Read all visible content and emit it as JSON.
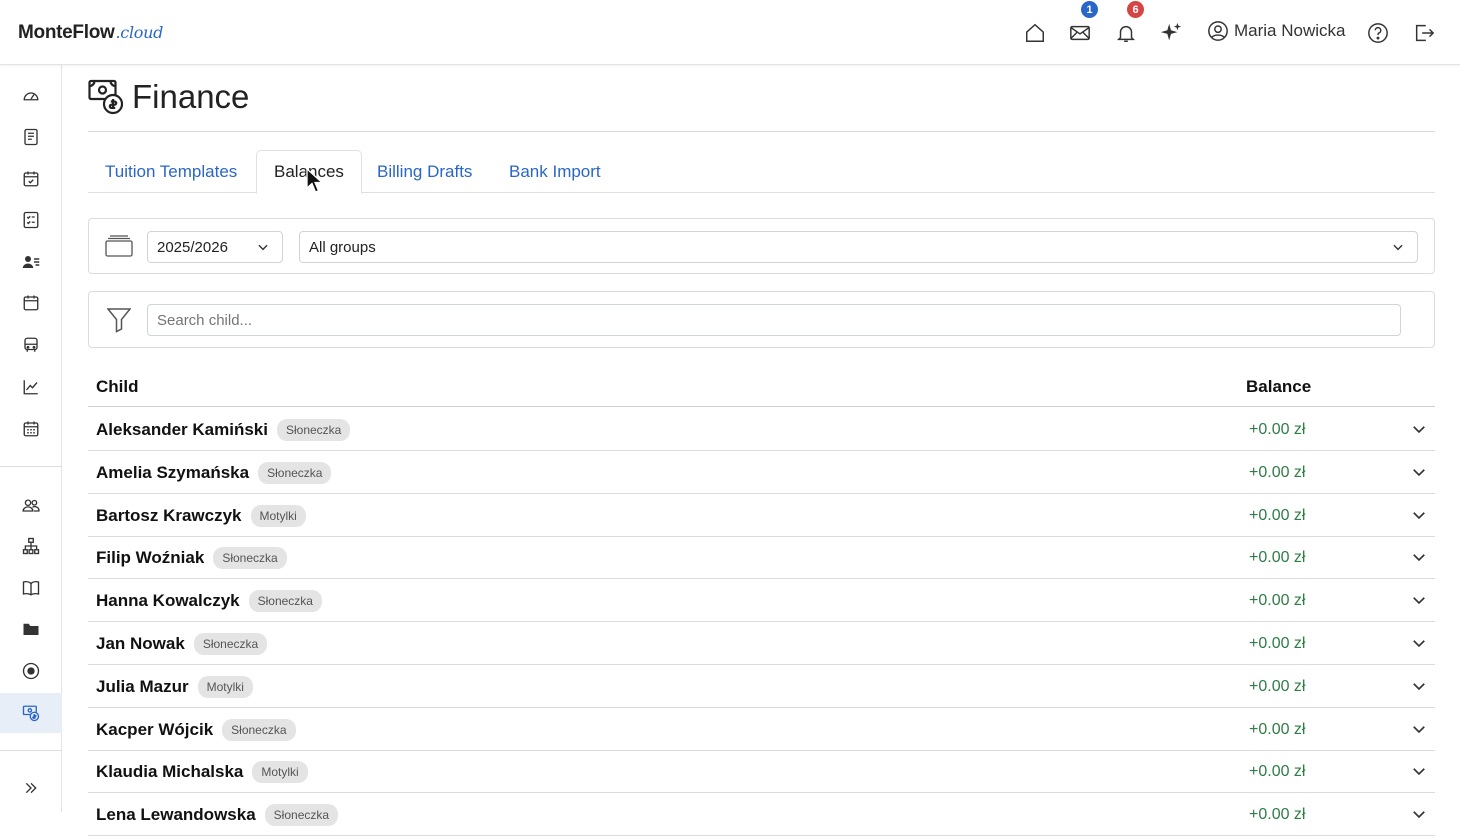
{
  "app": {
    "logo_main": "MonteFlow",
    "logo_suffix": ".cloud"
  },
  "topbar": {
    "messages_badge": "1",
    "notifications_badge": "6",
    "user_name": "Maria Nowicka",
    "colors": {
      "messages_badge": "#2a66c9",
      "notifications_badge": "#d64545"
    }
  },
  "page": {
    "title": "Finance"
  },
  "tabs": [
    {
      "label": "Tuition Templates"
    },
    {
      "label": "Balances"
    },
    {
      "label": "Billing Drafts"
    },
    {
      "label": "Bank Import"
    }
  ],
  "filters": {
    "year_selected": "2025/2026",
    "group_selected": "All groups",
    "search_placeholder": "Search child..."
  },
  "table": {
    "headers": {
      "child": "Child",
      "balance": "Balance"
    },
    "rows": [
      {
        "name": "Aleksander Kamiński",
        "group": "Słoneczka",
        "balance": "+0.00 zł"
      },
      {
        "name": "Amelia Szymańska",
        "group": "Słoneczka",
        "balance": "+0.00 zł"
      },
      {
        "name": "Bartosz Krawczyk",
        "group": "Motylki",
        "balance": "+0.00 zł"
      },
      {
        "name": "Filip Woźniak",
        "group": "Słoneczka",
        "balance": "+0.00 zł"
      },
      {
        "name": "Hanna Kowalczyk",
        "group": "Słoneczka",
        "balance": "+0.00 zł"
      },
      {
        "name": "Jan Nowak",
        "group": "Słoneczka",
        "balance": "+0.00 zł"
      },
      {
        "name": "Julia Mazur",
        "group": "Motylki",
        "balance": "+0.00 zł"
      },
      {
        "name": "Kacper Wójcik",
        "group": "Słoneczka",
        "balance": "+0.00 zł"
      },
      {
        "name": "Klaudia Michalska",
        "group": "Motylki",
        "balance": "+0.00 zł"
      },
      {
        "name": "Lena Lewandowska",
        "group": "Słoneczka",
        "balance": "+0.00 zł"
      }
    ]
  },
  "colors": {
    "accent": "#2a66c9",
    "positive_balance": "#2e7d45"
  }
}
